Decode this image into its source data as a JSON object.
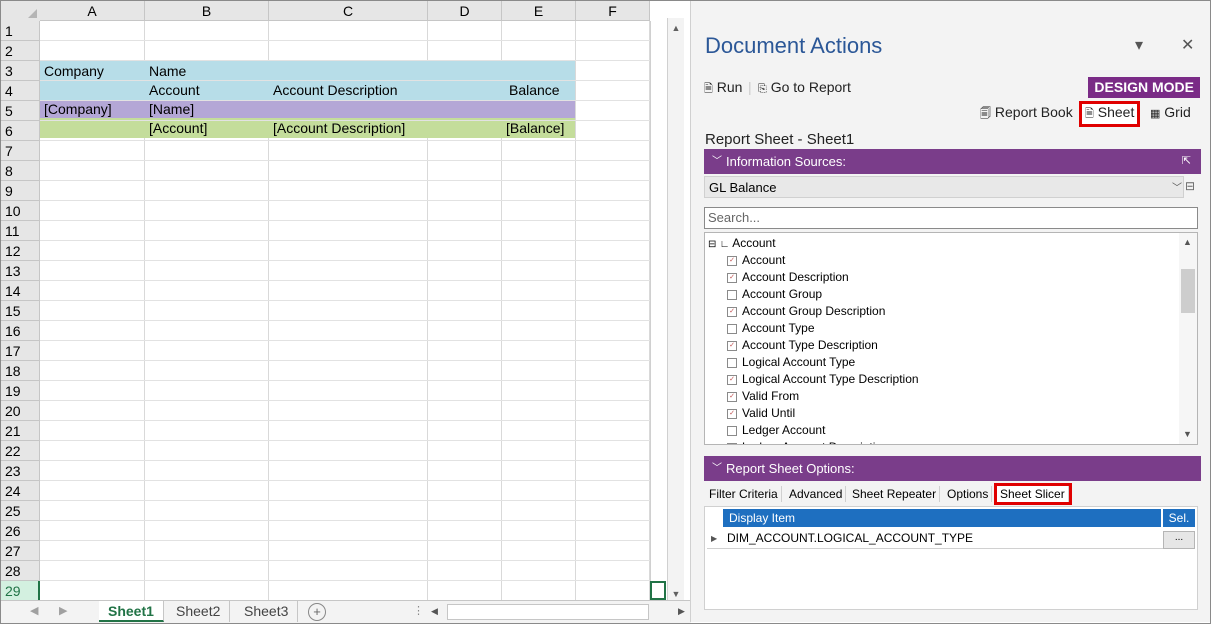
{
  "spreadsheet": {
    "columns": [
      "A",
      "B",
      "C",
      "D",
      "E",
      "F"
    ],
    "rows": [
      "1",
      "2",
      "3",
      "4",
      "5",
      "6",
      "7",
      "8",
      "9",
      "10",
      "11",
      "12",
      "13",
      "14",
      "15",
      "16",
      "17",
      "18",
      "19",
      "20",
      "21",
      "22",
      "23",
      "24",
      "25",
      "26",
      "27",
      "28",
      "29"
    ],
    "selected_row": "29",
    "band_colors": {
      "header": "#b7dde8",
      "group": "#b4a7d6",
      "detail": "#c4dd9b"
    },
    "cells": {
      "a2": "Company",
      "b2": "Name",
      "b3": "Account",
      "c3": "Account Description",
      "e3": "Balance",
      "a4": "[Company]",
      "b4": "[Name]",
      "b5": "[Account]",
      "c5": "[Account Description]",
      "e5": "[Balance]"
    },
    "sheet_tabs": [
      "Sheet1",
      "Sheet2",
      "Sheet3"
    ],
    "active_sheet": "Sheet1",
    "add_sheet_label": "+"
  },
  "pane": {
    "title": "Document Actions",
    "run_label": "Run",
    "goto_label": "Go to Report",
    "design_mode": "DESIGN MODE",
    "report_book_label": "Report Book",
    "sheet_label": "Sheet",
    "grid_label": "Grid",
    "subtitle": "Report Sheet - Sheet1",
    "info_sources_label": "Information Sources:",
    "source_selected": "GL Balance",
    "search_placeholder": "Search...",
    "tree_root": "Account",
    "tree_items": [
      {
        "label": "Account",
        "checked": true
      },
      {
        "label": "Account Description",
        "checked": true
      },
      {
        "label": "Account Group",
        "checked": false
      },
      {
        "label": "Account Group Description",
        "checked": true
      },
      {
        "label": "Account Type",
        "checked": false
      },
      {
        "label": "Account Type Description",
        "checked": true
      },
      {
        "label": "Logical Account Type",
        "checked": false
      },
      {
        "label": "Logical Account Type Description",
        "checked": true
      },
      {
        "label": "Valid From",
        "checked": true
      },
      {
        "label": "Valid Until",
        "checked": true
      },
      {
        "label": "Ledger Account",
        "checked": false
      },
      {
        "label": "Ledger Account Description",
        "checked": true
      }
    ],
    "options_label": "Report Sheet Options:",
    "option_tabs": [
      "Filter Criteria",
      "Advanced",
      "Sheet Repeater",
      "Options",
      "Sheet Slicer"
    ],
    "active_option_tab": "Sheet Slicer",
    "grid_header_display": "Display Item",
    "grid_header_sel": "Sel.",
    "grid_rows": [
      {
        "display": "DIM_ACCOUNT.LOGICAL_ACCOUNT_TYPE",
        "sel": "..."
      }
    ],
    "accent_purple": "#7a3d8a",
    "highlight_red": "#e00000"
  }
}
